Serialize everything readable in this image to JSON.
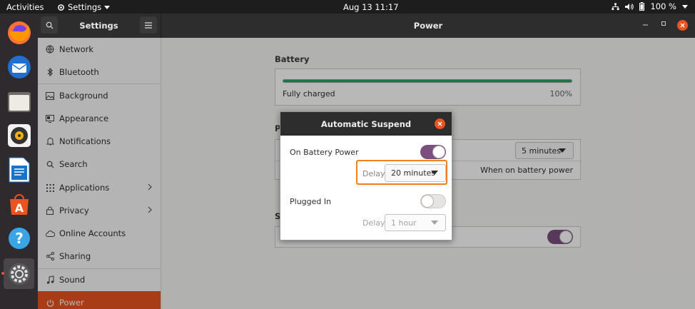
{
  "topbar": {
    "activities": "Activities",
    "app_menu": "Settings",
    "clock": "Aug 13  11:17",
    "battery": "100 %"
  },
  "dock": {
    "items": [
      "firefox-icon",
      "thunderbird-icon",
      "files-icon",
      "rhythmbox-icon",
      "libreoffice-writer-icon",
      "software-icon",
      "help-icon",
      "settings-icon"
    ]
  },
  "header": {
    "sidebar_title": "Settings",
    "page_title": "Power"
  },
  "sidebar": {
    "items": [
      {
        "label": "Network"
      },
      {
        "label": "Bluetooth"
      },
      {
        "label": "Background"
      },
      {
        "label": "Appearance"
      },
      {
        "label": "Notifications"
      },
      {
        "label": "Search"
      },
      {
        "label": "Applications"
      },
      {
        "label": "Privacy"
      },
      {
        "label": "Online Accounts"
      },
      {
        "label": "Sharing"
      },
      {
        "label": "Sound"
      },
      {
        "label": "Power"
      }
    ]
  },
  "main": {
    "battery_title": "Battery",
    "battery_status": "Fully charged",
    "battery_percent": "100%",
    "battery_level": 1.0,
    "power_title_fragment": "P",
    "suspend_title_fragment": "S",
    "blank_screen_value": "5 minutes",
    "suspend_value": "When on battery power"
  },
  "dialog": {
    "title": "Automatic Suspend",
    "battery_label": "On Battery Power",
    "battery_toggle": true,
    "battery_delay_label": "Delay",
    "battery_delay_value": "20 minutes",
    "plugged_label": "Plugged In",
    "plugged_toggle": false,
    "plugged_delay_label": "Delay",
    "plugged_delay_value": "1 hour"
  }
}
